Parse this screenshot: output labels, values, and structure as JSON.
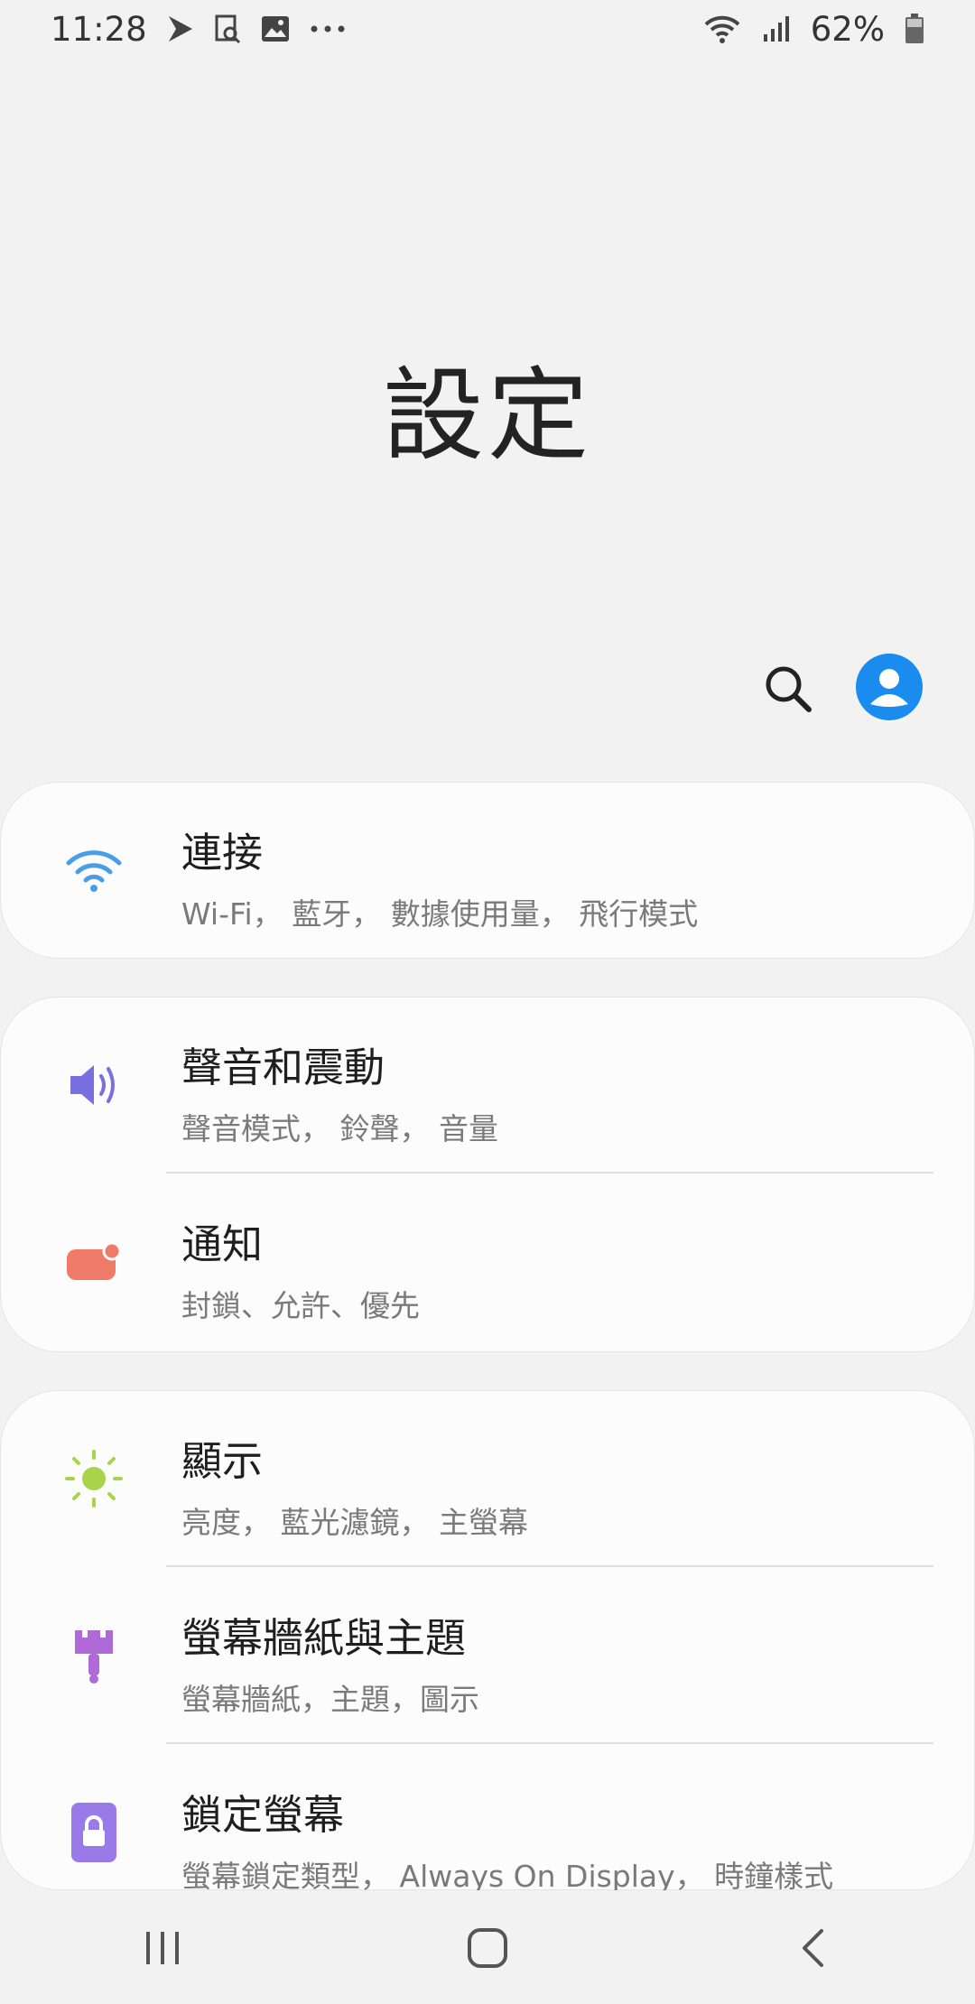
{
  "status_bar": {
    "time": "11:28",
    "battery_percent": "62%",
    "left_icons": [
      "play-store-icon",
      "screenshot-icon",
      "gallery-icon",
      "more-dots-icon"
    ],
    "right_icons": [
      "wifi-icon",
      "signal-icon",
      "battery-icon"
    ]
  },
  "header": {
    "title": "設定"
  },
  "actions": {
    "search_icon": "search-icon",
    "profile_icon": "account-avatar-icon",
    "profile_color": "#1a8cf0"
  },
  "cards": [
    {
      "items": [
        {
          "title": "連接",
          "subtitle": "Wi-Fi， 藍牙， 數據使用量， 飛行模式",
          "icon": "wifi-icon",
          "icon_color": "#4a9ee8"
        }
      ]
    },
    {
      "items": [
        {
          "title": "聲音和震動",
          "subtitle": "聲音模式， 鈴聲， 音量",
          "icon": "volume-icon",
          "icon_color": "#7a6fe0"
        },
        {
          "title": "通知",
          "subtitle": "封鎖、允許、優先",
          "icon": "notification-icon",
          "icon_color": "#f07a6a"
        }
      ]
    },
    {
      "items": [
        {
          "title": "顯示",
          "subtitle": "亮度， 藍光濾鏡， 主螢幕",
          "icon": "brightness-icon",
          "icon_color": "#a8d44a"
        },
        {
          "title": "螢幕牆紙與主題",
          "subtitle": "螢幕牆紙，主題，圖示",
          "icon": "paintbrush-icon",
          "icon_color": "#b06ad8"
        },
        {
          "title": "鎖定螢幕",
          "subtitle": "螢幕鎖定類型， Always On Display， 時鐘樣式",
          "icon": "lock-icon",
          "icon_color": "#9a7ae8"
        }
      ]
    }
  ],
  "nav_bar": {
    "buttons": [
      "recent-apps-icon",
      "home-icon",
      "back-icon"
    ]
  }
}
